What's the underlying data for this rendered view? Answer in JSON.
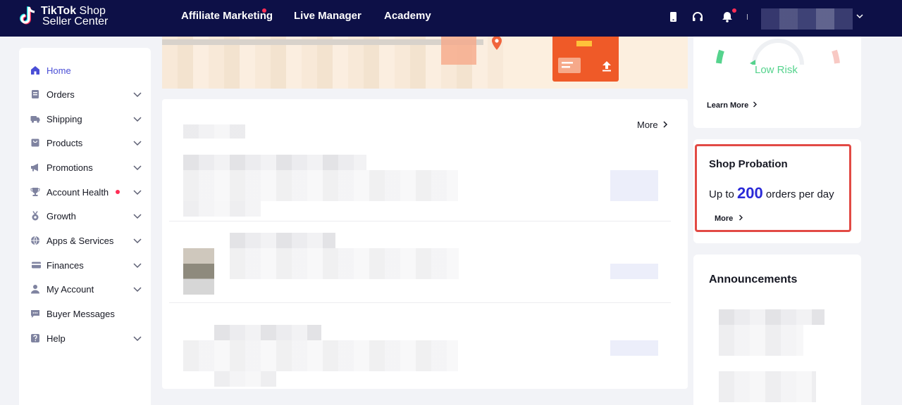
{
  "brand": {
    "line1_bold": "TikTok",
    "line1_rest": " Shop",
    "line2": "Seller Center"
  },
  "top_nav": [
    {
      "label": "Affiliate Marketing",
      "has_badge": true
    },
    {
      "label": "Live Manager",
      "has_badge": false
    },
    {
      "label": "Academy",
      "has_badge": false
    }
  ],
  "top_icons": [
    "phone-icon",
    "headset-icon",
    "bell-icon"
  ],
  "sidebar": {
    "items": [
      {
        "label": "Home",
        "icon": "home-icon",
        "active": true,
        "expandable": false
      },
      {
        "label": "Orders",
        "icon": "orders-icon",
        "expandable": true
      },
      {
        "label": "Shipping",
        "icon": "truck-icon",
        "expandable": true
      },
      {
        "label": "Products",
        "icon": "bag-icon",
        "expandable": true
      },
      {
        "label": "Promotions",
        "icon": "megaphone-icon",
        "expandable": true
      },
      {
        "label": "Account Health",
        "icon": "trophy-icon",
        "expandable": true,
        "has_badge": true
      },
      {
        "label": "Growth",
        "icon": "medal-icon",
        "expandable": true
      },
      {
        "label": "Apps & Services",
        "icon": "globe-icon",
        "expandable": true
      },
      {
        "label": "Finances",
        "icon": "card-icon",
        "expandable": true
      },
      {
        "label": "My Account",
        "icon": "user-icon",
        "expandable": true
      },
      {
        "label": "Buyer Messages",
        "icon": "chat-icon",
        "expandable": false
      },
      {
        "label": "Help",
        "icon": "help-icon",
        "expandable": true
      }
    ]
  },
  "main": {
    "more_label": "More"
  },
  "account_health": {
    "status": "Low Risk",
    "learn_more": "Learn More"
  },
  "shop_probation": {
    "title": "Shop Probation",
    "prefix": "Up to",
    "limit": "200",
    "suffix": "orders per day",
    "more": "More"
  },
  "announcements": {
    "title": "Announcements"
  },
  "colors": {
    "nav_bg": "#0d1047",
    "accent": "#4a4ed6",
    "danger": "#e24a45",
    "low_risk": "#55d38d",
    "limit": "#2b2ad8"
  }
}
